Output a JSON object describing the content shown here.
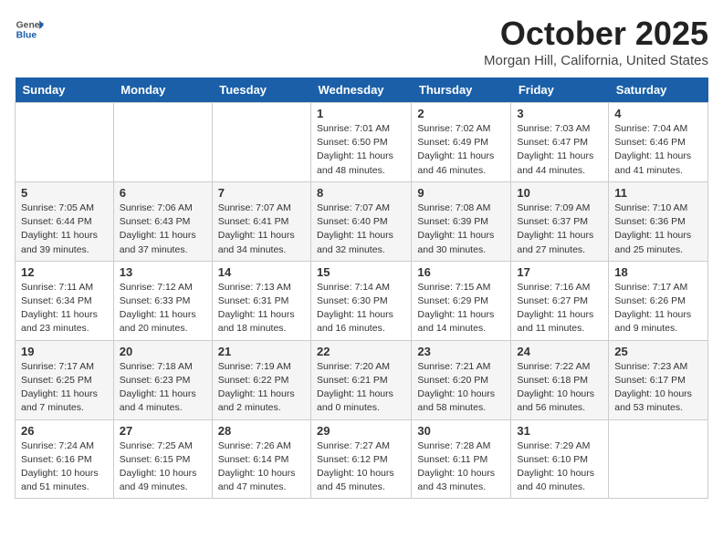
{
  "logo": {
    "general": "General",
    "blue": "Blue"
  },
  "header": {
    "month": "October 2025",
    "location": "Morgan Hill, California, United States"
  },
  "weekdays": [
    "Sunday",
    "Monday",
    "Tuesday",
    "Wednesday",
    "Thursday",
    "Friday",
    "Saturday"
  ],
  "weeks": [
    [
      {
        "day": "",
        "sunrise": "",
        "sunset": "",
        "daylight": ""
      },
      {
        "day": "",
        "sunrise": "",
        "sunset": "",
        "daylight": ""
      },
      {
        "day": "",
        "sunrise": "",
        "sunset": "",
        "daylight": ""
      },
      {
        "day": "1",
        "sunrise": "Sunrise: 7:01 AM",
        "sunset": "Sunset: 6:50 PM",
        "daylight": "Daylight: 11 hours and 48 minutes."
      },
      {
        "day": "2",
        "sunrise": "Sunrise: 7:02 AM",
        "sunset": "Sunset: 6:49 PM",
        "daylight": "Daylight: 11 hours and 46 minutes."
      },
      {
        "day": "3",
        "sunrise": "Sunrise: 7:03 AM",
        "sunset": "Sunset: 6:47 PM",
        "daylight": "Daylight: 11 hours and 44 minutes."
      },
      {
        "day": "4",
        "sunrise": "Sunrise: 7:04 AM",
        "sunset": "Sunset: 6:46 PM",
        "daylight": "Daylight: 11 hours and 41 minutes."
      }
    ],
    [
      {
        "day": "5",
        "sunrise": "Sunrise: 7:05 AM",
        "sunset": "Sunset: 6:44 PM",
        "daylight": "Daylight: 11 hours and 39 minutes."
      },
      {
        "day": "6",
        "sunrise": "Sunrise: 7:06 AM",
        "sunset": "Sunset: 6:43 PM",
        "daylight": "Daylight: 11 hours and 37 minutes."
      },
      {
        "day": "7",
        "sunrise": "Sunrise: 7:07 AM",
        "sunset": "Sunset: 6:41 PM",
        "daylight": "Daylight: 11 hours and 34 minutes."
      },
      {
        "day": "8",
        "sunrise": "Sunrise: 7:07 AM",
        "sunset": "Sunset: 6:40 PM",
        "daylight": "Daylight: 11 hours and 32 minutes."
      },
      {
        "day": "9",
        "sunrise": "Sunrise: 7:08 AM",
        "sunset": "Sunset: 6:39 PM",
        "daylight": "Daylight: 11 hours and 30 minutes."
      },
      {
        "day": "10",
        "sunrise": "Sunrise: 7:09 AM",
        "sunset": "Sunset: 6:37 PM",
        "daylight": "Daylight: 11 hours and 27 minutes."
      },
      {
        "day": "11",
        "sunrise": "Sunrise: 7:10 AM",
        "sunset": "Sunset: 6:36 PM",
        "daylight": "Daylight: 11 hours and 25 minutes."
      }
    ],
    [
      {
        "day": "12",
        "sunrise": "Sunrise: 7:11 AM",
        "sunset": "Sunset: 6:34 PM",
        "daylight": "Daylight: 11 hours and 23 minutes."
      },
      {
        "day": "13",
        "sunrise": "Sunrise: 7:12 AM",
        "sunset": "Sunset: 6:33 PM",
        "daylight": "Daylight: 11 hours and 20 minutes."
      },
      {
        "day": "14",
        "sunrise": "Sunrise: 7:13 AM",
        "sunset": "Sunset: 6:31 PM",
        "daylight": "Daylight: 11 hours and 18 minutes."
      },
      {
        "day": "15",
        "sunrise": "Sunrise: 7:14 AM",
        "sunset": "Sunset: 6:30 PM",
        "daylight": "Daylight: 11 hours and 16 minutes."
      },
      {
        "day": "16",
        "sunrise": "Sunrise: 7:15 AM",
        "sunset": "Sunset: 6:29 PM",
        "daylight": "Daylight: 11 hours and 14 minutes."
      },
      {
        "day": "17",
        "sunrise": "Sunrise: 7:16 AM",
        "sunset": "Sunset: 6:27 PM",
        "daylight": "Daylight: 11 hours and 11 minutes."
      },
      {
        "day": "18",
        "sunrise": "Sunrise: 7:17 AM",
        "sunset": "Sunset: 6:26 PM",
        "daylight": "Daylight: 11 hours and 9 minutes."
      }
    ],
    [
      {
        "day": "19",
        "sunrise": "Sunrise: 7:17 AM",
        "sunset": "Sunset: 6:25 PM",
        "daylight": "Daylight: 11 hours and 7 minutes."
      },
      {
        "day": "20",
        "sunrise": "Sunrise: 7:18 AM",
        "sunset": "Sunset: 6:23 PM",
        "daylight": "Daylight: 11 hours and 4 minutes."
      },
      {
        "day": "21",
        "sunrise": "Sunrise: 7:19 AM",
        "sunset": "Sunset: 6:22 PM",
        "daylight": "Daylight: 11 hours and 2 minutes."
      },
      {
        "day": "22",
        "sunrise": "Sunrise: 7:20 AM",
        "sunset": "Sunset: 6:21 PM",
        "daylight": "Daylight: 11 hours and 0 minutes."
      },
      {
        "day": "23",
        "sunrise": "Sunrise: 7:21 AM",
        "sunset": "Sunset: 6:20 PM",
        "daylight": "Daylight: 10 hours and 58 minutes."
      },
      {
        "day": "24",
        "sunrise": "Sunrise: 7:22 AM",
        "sunset": "Sunset: 6:18 PM",
        "daylight": "Daylight: 10 hours and 56 minutes."
      },
      {
        "day": "25",
        "sunrise": "Sunrise: 7:23 AM",
        "sunset": "Sunset: 6:17 PM",
        "daylight": "Daylight: 10 hours and 53 minutes."
      }
    ],
    [
      {
        "day": "26",
        "sunrise": "Sunrise: 7:24 AM",
        "sunset": "Sunset: 6:16 PM",
        "daylight": "Daylight: 10 hours and 51 minutes."
      },
      {
        "day": "27",
        "sunrise": "Sunrise: 7:25 AM",
        "sunset": "Sunset: 6:15 PM",
        "daylight": "Daylight: 10 hours and 49 minutes."
      },
      {
        "day": "28",
        "sunrise": "Sunrise: 7:26 AM",
        "sunset": "Sunset: 6:14 PM",
        "daylight": "Daylight: 10 hours and 47 minutes."
      },
      {
        "day": "29",
        "sunrise": "Sunrise: 7:27 AM",
        "sunset": "Sunset: 6:12 PM",
        "daylight": "Daylight: 10 hours and 45 minutes."
      },
      {
        "day": "30",
        "sunrise": "Sunrise: 7:28 AM",
        "sunset": "Sunset: 6:11 PM",
        "daylight": "Daylight: 10 hours and 43 minutes."
      },
      {
        "day": "31",
        "sunrise": "Sunrise: 7:29 AM",
        "sunset": "Sunset: 6:10 PM",
        "daylight": "Daylight: 10 hours and 40 minutes."
      },
      {
        "day": "",
        "sunrise": "",
        "sunset": "",
        "daylight": ""
      }
    ]
  ]
}
